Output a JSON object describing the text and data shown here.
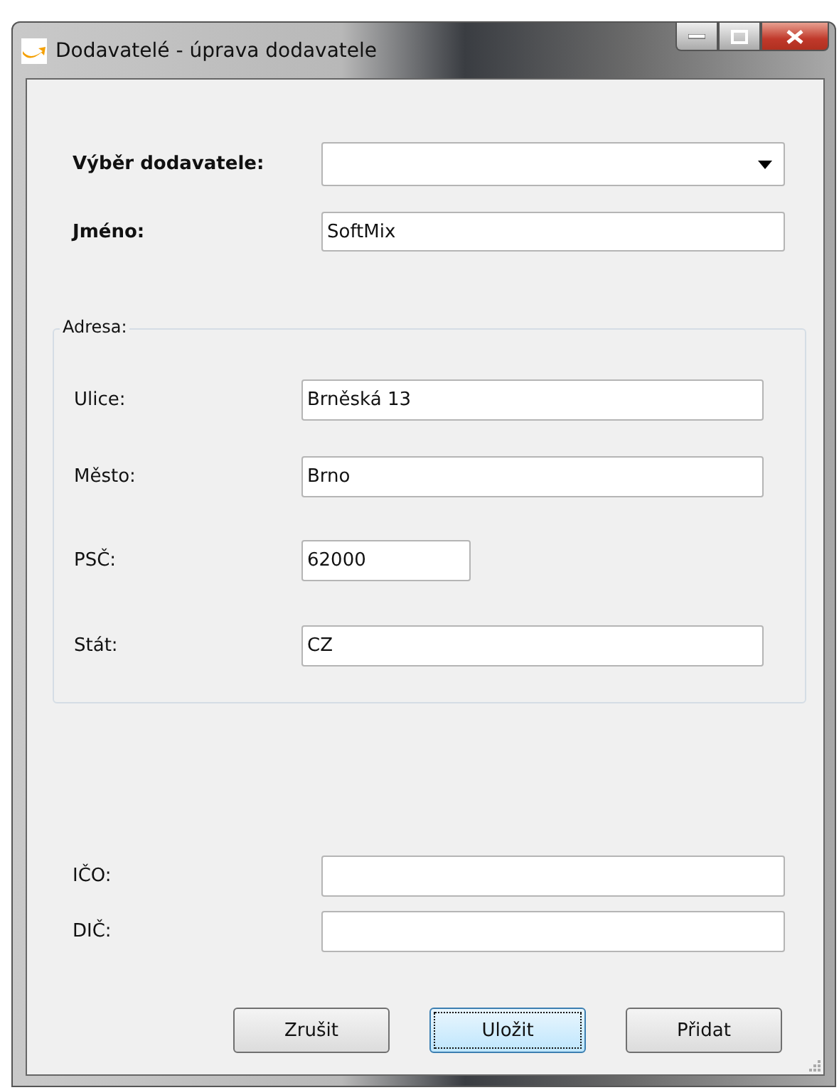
{
  "window": {
    "title": "Dodavatelé - úprava dodavatele"
  },
  "supplier_select": {
    "label": "Výběr dodavatele:"
  },
  "name": {
    "label": "Jméno:",
    "value": "SoftMix"
  },
  "address": {
    "legend": "Adresa:",
    "fields": [
      {
        "label": "Ulice:",
        "value": "Brněská 13",
        "kind": "wide"
      },
      {
        "label": "Město:",
        "value": "Brno",
        "kind": "wide"
      },
      {
        "label": "PSČ:",
        "value": "62000",
        "kind": "short"
      },
      {
        "label": "Stát:",
        "value": "CZ",
        "kind": "wide"
      }
    ]
  },
  "ids": [
    {
      "label": "IČO:"
    },
    {
      "label": "DIČ:"
    }
  ],
  "buttons": [
    {
      "label": "Zrušit",
      "focused": false
    },
    {
      "label": "Uložit",
      "focused": true
    },
    {
      "label": "Přidat",
      "focused": false
    }
  ]
}
